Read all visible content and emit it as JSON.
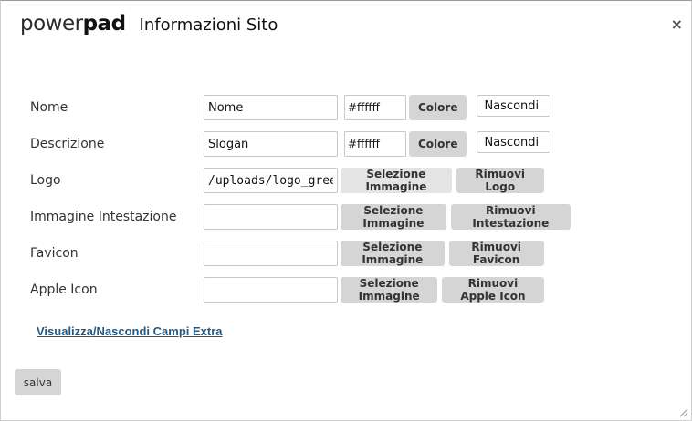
{
  "header": {
    "logo_power": "power",
    "logo_pad": "pad",
    "title": "Informazioni Sito",
    "close_glyph": "×"
  },
  "fields": {
    "nome": {
      "label": "Nome",
      "value": "Nome",
      "color_value": "#ffffff",
      "color_button": "Colore",
      "hide_value": "Nascondi"
    },
    "descrizione": {
      "label": "Descrizione",
      "value": "Slogan",
      "color_value": "#ffffff",
      "color_button": "Colore",
      "hide_value": "Nascondi"
    },
    "logo": {
      "label": "Logo",
      "value": "/uploads/logo_green",
      "select_button": "Selezione Immagine",
      "remove_button": "Rimuovi Logo"
    },
    "header_image": {
      "label": "Immagine Intestazione",
      "value": "",
      "select_button": "Selezione Immagine",
      "remove_button": "Rimuovi Intestazione"
    },
    "favicon": {
      "label": "Favicon",
      "value": "",
      "select_button": "Selezione Immagine",
      "remove_button": "Rimuovi Favicon"
    },
    "apple_icon": {
      "label": "Apple Icon",
      "value": "",
      "select_button": "Selezione Immagine",
      "remove_button": "Rimuovi Apple Icon"
    }
  },
  "extra_link": "Visualizza/Nascondi Campi Extra",
  "save_label": "salva",
  "icons": {
    "close": "close-icon",
    "resize": "resize-grip-icon"
  }
}
